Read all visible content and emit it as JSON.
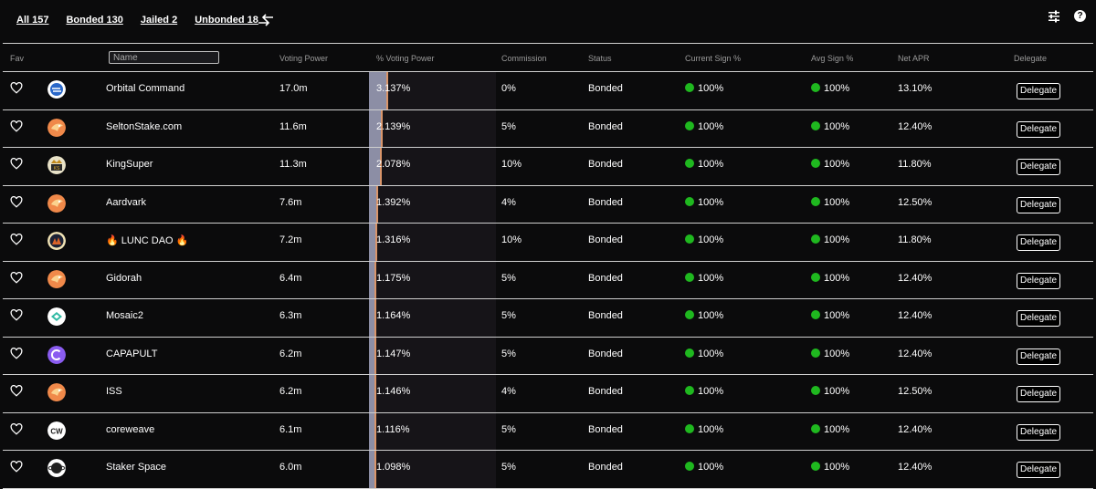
{
  "filters": [
    {
      "label": "All 157"
    },
    {
      "label": "Bonded 130"
    },
    {
      "label": "Jailed 2"
    },
    {
      "label": "Unbonded 18"
    }
  ],
  "help_label": "?",
  "headers": {
    "fav": "Fav",
    "voting_power": "Voting Power",
    "pct_voting_power": "% Voting Power",
    "commission": "Commission",
    "status": "Status",
    "current_sign": "Current Sign %",
    "avg_sign": "Avg Sign %",
    "net_apr": "Net APR",
    "delegate": "Delegate"
  },
  "name_placeholder": "Name",
  "delegate_label": "Delegate",
  "accent_colors": {
    "bar": "#8c8ea5",
    "bar_edge": "#d9956a",
    "ok_dot": "#1fb81f"
  },
  "rows": [
    {
      "logo": "orbital-command-logo",
      "name": "Orbital Command",
      "voting_power": "17.0m",
      "pct": "3.137%",
      "pct_value": 3.137,
      "commission": "0%",
      "status": "Bonded",
      "current_sign": "100%",
      "avg_sign": "100%",
      "apr": "13.10%"
    },
    {
      "logo": "orange-bird-logo",
      "name": "SeltonStake.com",
      "voting_power": "11.6m",
      "pct": "2.139%",
      "pct_value": 2.139,
      "commission": "5%",
      "status": "Bonded",
      "current_sign": "100%",
      "avg_sign": "100%",
      "apr": "12.40%"
    },
    {
      "logo": "kingsuper-logo",
      "name": "KingSuper",
      "voting_power": "11.3m",
      "pct": "2.078%",
      "pct_value": 2.078,
      "commission": "10%",
      "status": "Bonded",
      "current_sign": "100%",
      "avg_sign": "100%",
      "apr": "11.80%"
    },
    {
      "logo": "orange-bird-logo",
      "name": "Aardvark",
      "voting_power": "7.6m",
      "pct": "1.392%",
      "pct_value": 1.392,
      "commission": "4%",
      "status": "Bonded",
      "current_sign": "100%",
      "avg_sign": "100%",
      "apr": "12.50%"
    },
    {
      "logo": "lunc-dao-logo",
      "name": "🔥 LUNC DAO 🔥",
      "voting_power": "7.2m",
      "pct": "1.316%",
      "pct_value": 1.316,
      "commission": "10%",
      "status": "Bonded",
      "current_sign": "100%",
      "avg_sign": "100%",
      "apr": "11.80%"
    },
    {
      "logo": "orange-bird-logo",
      "name": "Gidorah",
      "voting_power": "6.4m",
      "pct": "1.175%",
      "pct_value": 1.175,
      "commission": "5%",
      "status": "Bonded",
      "current_sign": "100%",
      "avg_sign": "100%",
      "apr": "12.40%"
    },
    {
      "logo": "mosaic-logo",
      "name": "Mosaic2",
      "voting_power": "6.3m",
      "pct": "1.164%",
      "pct_value": 1.164,
      "commission": "5%",
      "status": "Bonded",
      "current_sign": "100%",
      "avg_sign": "100%",
      "apr": "12.40%"
    },
    {
      "logo": "capapult-logo",
      "name": "CAPAPULT",
      "voting_power": "6.2m",
      "pct": "1.147%",
      "pct_value": 1.147,
      "commission": "5%",
      "status": "Bonded",
      "current_sign": "100%",
      "avg_sign": "100%",
      "apr": "12.40%"
    },
    {
      "logo": "orange-bird-logo",
      "name": "ISS",
      "voting_power": "6.2m",
      "pct": "1.146%",
      "pct_value": 1.146,
      "commission": "4%",
      "status": "Bonded",
      "current_sign": "100%",
      "avg_sign": "100%",
      "apr": "12.50%"
    },
    {
      "logo": "coreweave-logo",
      "name": "coreweave",
      "voting_power": "6.1m",
      "pct": "1.116%",
      "pct_value": 1.116,
      "commission": "5%",
      "status": "Bonded",
      "current_sign": "100%",
      "avg_sign": "100%",
      "apr": "12.40%"
    },
    {
      "logo": "staker-space-logo",
      "name": "Staker Space",
      "voting_power": "6.0m",
      "pct": "1.098%",
      "pct_value": 1.098,
      "commission": "5%",
      "status": "Bonded",
      "current_sign": "100%",
      "avg_sign": "100%",
      "apr": "12.40%"
    }
  ]
}
